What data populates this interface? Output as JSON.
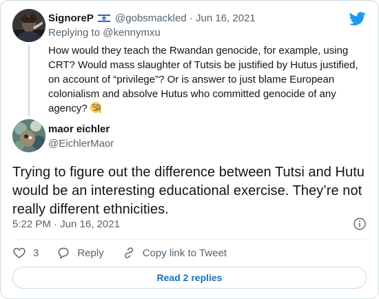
{
  "parent_tweet": {
    "display_name": "SignoreP",
    "handle": "@gobsmackled",
    "separator": "·",
    "date": "Jun 16, 2021",
    "replying_prefix": "Replying to",
    "replying_to": "@kennymxu",
    "text": "How would they teach the Rwandan genocide, for example, using CRT? Would mass slaughter of Tutsis be justified by Hutus justified, on account of “privilege”? Or is answer to just blame European colonialism and absolve Hutus who committed genocide of any agency?",
    "flag_icon": "israel-flag-icon",
    "emoji_icon": "face-with-monocle-icon"
  },
  "reply_tweet": {
    "display_name": "maor eichler",
    "handle": "@EichlerMaor",
    "text": "Trying to figure out the difference between Tutsi and Hutu would be an interesting educational exercise. They’re not really different ethnicities.",
    "timestamp": "5:22 PM · Jun 16, 2021"
  },
  "actions": {
    "like_count": "3",
    "reply_label": "Reply",
    "copy_link_label": "Copy link to Tweet"
  },
  "read_replies_label": "Read 2 replies",
  "colors": {
    "brand": "#1d9bf0",
    "text": "#0f1419",
    "muted": "#536471",
    "border": "#cfd9de",
    "link": "#1d6ec0"
  }
}
